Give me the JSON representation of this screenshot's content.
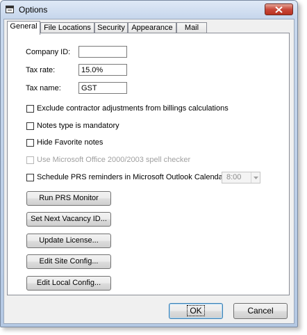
{
  "window": {
    "title": "Options"
  },
  "tabs": [
    {
      "label": "General",
      "active": true
    },
    {
      "label": "File Locations",
      "active": false
    },
    {
      "label": "Security",
      "active": false
    },
    {
      "label": "Appearance",
      "active": false
    },
    {
      "label": "Mail",
      "active": false
    }
  ],
  "fields": {
    "company_id": {
      "label": "Company ID:",
      "value": ""
    },
    "tax_rate": {
      "label": "Tax rate:",
      "value": "15.0%"
    },
    "tax_name": {
      "label": "Tax name:",
      "value": "GST"
    }
  },
  "checkboxes": [
    {
      "label": "Exclude  contractor adjustments from billings calculations",
      "checked": false,
      "enabled": true
    },
    {
      "label": "Notes type is mandatory",
      "checked": false,
      "enabled": true
    },
    {
      "label": "Hide Favorite notes",
      "checked": false,
      "enabled": true
    },
    {
      "label": "Use Microsoft Office 2000/2003 spell checker",
      "checked": false,
      "enabled": false
    },
    {
      "label": "Schedule PRS reminders in Microsoft Outlook Calendar at:",
      "checked": false,
      "enabled": true
    }
  ],
  "reminder_time": {
    "value": "8:00",
    "enabled": false
  },
  "action_buttons": [
    {
      "label": "Run PRS Monitor"
    },
    {
      "label": "Set Next Vacancy ID..."
    },
    {
      "label": "Update License..."
    },
    {
      "label": "Edit Site Config..."
    },
    {
      "label": "Edit Local Config..."
    }
  ],
  "footer": {
    "ok_label": "OK",
    "cancel_label": "Cancel"
  },
  "colors": {
    "close_button": "#c8483a",
    "default_button_border": "#3c7fb1",
    "disabled_text": "#a0a0a0"
  },
  "icons": {
    "app": "form-window-icon",
    "close": "close-icon",
    "dropdown": "chevron-down-icon"
  }
}
